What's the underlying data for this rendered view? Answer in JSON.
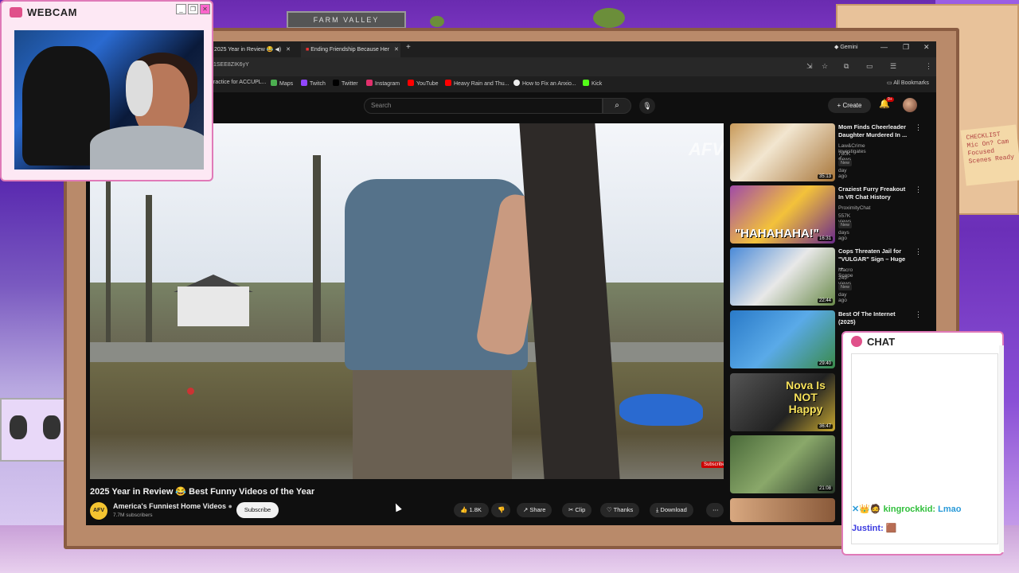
{
  "webcam": {
    "title": "WEBCAM"
  },
  "chat": {
    "title": "CHAT",
    "messages": [
      {
        "user": "kingrockkid",
        "text": "Lmao",
        "color": "#2fbf3a",
        "badges": "✕👑🧔"
      },
      {
        "user": "Justint",
        "text": "🟫",
        "color": "#3a3ae0",
        "badges": ""
      }
    ]
  },
  "browser": {
    "tabs": [
      {
        "label": "2025 Year in Review 😂 ◀)"
      },
      {
        "label": "Ending Friendship Because Her"
      }
    ],
    "gemini": "Gemini",
    "url": "1SEE8ZIK6yY",
    "bookmarks": [
      "ractice for ACCUPL...",
      "Maps",
      "Twitch",
      "Twitter",
      "Instagram",
      "YouTube",
      "Heavy Rain and Thu...",
      "How to Fix an Anxio...",
      "Kick"
    ],
    "all_bookmarks": "All Bookmarks"
  },
  "youtube": {
    "search_placeholder": "Search",
    "create_label": "Create",
    "notif_count": "9+",
    "video": {
      "title": "2025 Year in Review 😂 Best Funny Videos of the Year",
      "channel": "America's Funniest Home Videos",
      "channel_logo": "AFV",
      "subscribers": "7.7M subscribers",
      "subscribe_label": "Subscribe",
      "likes": "1.8K",
      "share_label": "Share",
      "clip_label": "Clip",
      "thanks_label": "Thanks",
      "download_label": "Download",
      "watermark": "AFV",
      "subscribe_tag": "Subscribe"
    },
    "recommended": [
      {
        "title": "Mom Finds Cheerleader Daughter Murdered In ...",
        "channel": "Law&Crime Investigates ✓",
        "meta": "780K views • 1 day ago",
        "badge": "New",
        "duration": "35:13"
      },
      {
        "title": "Craziest Furry Freakout In VR Chat History",
        "channel": "ProximityChat",
        "meta": "557K views • 2 days ago",
        "badge": "New",
        "duration": "16:31",
        "thumb_text": "\"HAHAHAHA!\""
      },
      {
        "title": "Cops Threaten Jail for \"VULGAR\" Sign – Huge ...",
        "channel": "Macro Scope",
        "meta": "249 views • 1 day ago",
        "badge": "New",
        "duration": "22:44"
      },
      {
        "title": "Best Of The Internet (2025)",
        "channel": "",
        "meta": "",
        "badge": "",
        "duration": "29:40"
      },
      {
        "title": "",
        "channel": "",
        "meta": "",
        "badge": "",
        "duration": "36:47",
        "thumb_text": "Nova Is NOT Happy"
      },
      {
        "title": "",
        "channel": "",
        "meta": "",
        "badge": "",
        "duration": "21:08"
      }
    ]
  },
  "decor": {
    "tv_label": "FARM VALLEY",
    "note_text": "CHECKLIST Mic On? Cam Focused Scenes Ready"
  }
}
